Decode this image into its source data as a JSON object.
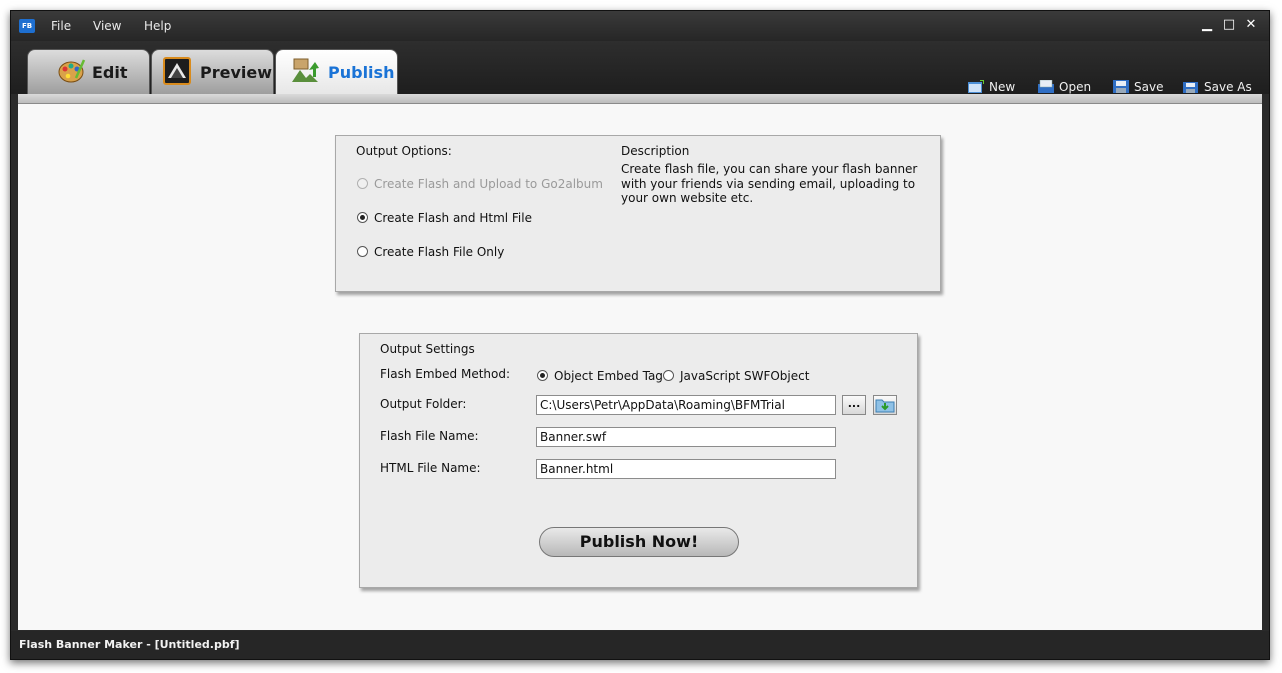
{
  "app": {
    "logo_text": "FB"
  },
  "menu": {
    "items": [
      "File",
      "View",
      "Help"
    ]
  },
  "window_controls": {
    "minimize": "▁",
    "maximize": "□",
    "close": "✕"
  },
  "tabs": [
    {
      "label": "Edit",
      "icon": "palette-icon"
    },
    {
      "label": "Preview",
      "icon": "preview-icon"
    },
    {
      "label": "Publish",
      "icon": "publish-icon",
      "active": true
    }
  ],
  "toolbar": {
    "new_label": "New",
    "open_label": "Open",
    "save_label": "Save",
    "save_as_label": "Save As"
  },
  "output_options": {
    "heading": "Output Options:",
    "options": [
      {
        "label": "Create Flash and Upload to Go2album",
        "checked": false,
        "disabled": true
      },
      {
        "label": "Create Flash and Html File",
        "checked": true,
        "disabled": false
      },
      {
        "label": "Create Flash File Only",
        "checked": false,
        "disabled": false
      }
    ],
    "description_heading": "Description",
    "description": "Create flash file, you can share your flash banner with your friends via sending email, uploading to your own website etc."
  },
  "output_settings": {
    "heading": "Output Settings",
    "embed_method_label": "Flash Embed Method:",
    "embed_options": [
      {
        "label": "Object Embed Tag",
        "checked": true
      },
      {
        "label": "JavaScript SWFObject",
        "checked": false
      }
    ],
    "output_folder_label": "Output Folder:",
    "output_folder_value": "C:\\Users\\Petr\\AppData\\Roaming\\BFMTrial",
    "browse_label": "...",
    "flash_name_label": "Flash File Name:",
    "flash_name_value": "Banner.swf",
    "html_name_label": "HTML File Name:",
    "html_name_value": "Banner.html",
    "publish_label": "Publish Now!"
  },
  "status": {
    "text": "Flash Banner Maker - [Untitled.pbf]"
  },
  "colors": {
    "accent": "#1a73d6",
    "chrome": "#2a2a2a"
  }
}
